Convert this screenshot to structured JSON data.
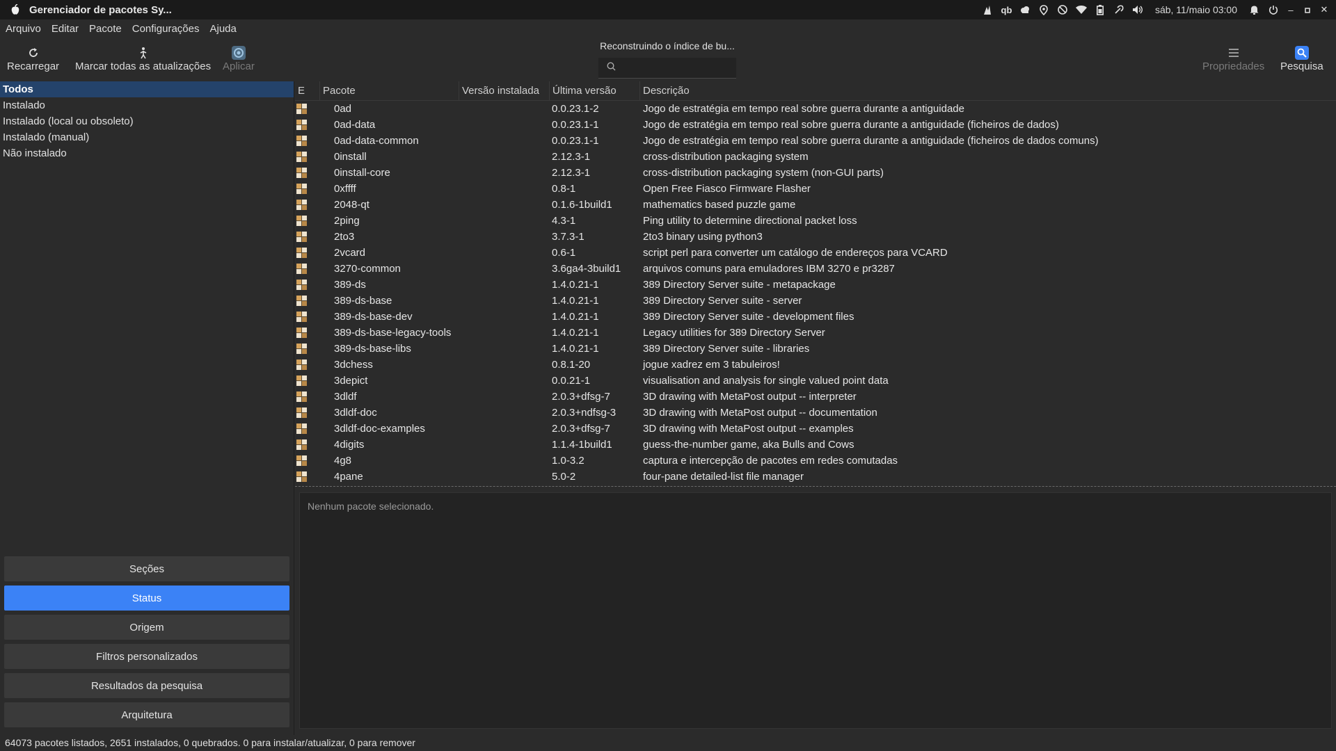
{
  "window": {
    "title": "Gerenciador de pacotes Sy...",
    "clock": "sáb, 11/maio  03:00"
  },
  "menu": [
    "Arquivo",
    "Editar",
    "Pacote",
    "Configurações",
    "Ajuda"
  ],
  "toolbar": {
    "reload": "Recarregar",
    "mark_all": "Marcar todas as atualizações",
    "apply": "Aplicar",
    "properties": "Propriedades",
    "search": "Pesquisa"
  },
  "search": {
    "status": "Reconstruindo o índice de bu...",
    "placeholder": ""
  },
  "filters": [
    "Todos",
    "Instalado",
    "Instalado (local ou obsoleto)",
    "Instalado (manual)",
    "Não instalado"
  ],
  "sidebar_buttons": [
    "Seções",
    "Status",
    "Origem",
    "Filtros personalizados",
    "Resultados da pesquisa",
    "Arquitetura"
  ],
  "columns": {
    "e": "E",
    "package": "Pacote",
    "installed": "Versão instalada",
    "latest": "Última versão",
    "description": "Descrição"
  },
  "packages": [
    {
      "name": "0ad",
      "installed": "",
      "latest": "0.0.23.1-2",
      "desc": "Jogo de estratégia em tempo real  sobre guerra durante a antiguidade"
    },
    {
      "name": "0ad-data",
      "installed": "",
      "latest": "0.0.23.1-1",
      "desc": "Jogo de estratégia em tempo real  sobre guerra durante a antiguidade (ficheiros de dados)"
    },
    {
      "name": "0ad-data-common",
      "installed": "",
      "latest": "0.0.23.1-1",
      "desc": "Jogo de estratégia em tempo real  sobre guerra durante a antiguidade (ficheiros de dados comuns)"
    },
    {
      "name": "0install",
      "installed": "",
      "latest": "2.12.3-1",
      "desc": "cross-distribution packaging system"
    },
    {
      "name": "0install-core",
      "installed": "",
      "latest": "2.12.3-1",
      "desc": "cross-distribution packaging system (non-GUI parts)"
    },
    {
      "name": "0xffff",
      "installed": "",
      "latest": "0.8-1",
      "desc": "Open Free Fiasco Firmware Flasher"
    },
    {
      "name": "2048-qt",
      "installed": "",
      "latest": "0.1.6-1build1",
      "desc": "mathematics based puzzle game"
    },
    {
      "name": "2ping",
      "installed": "",
      "latest": "4.3-1",
      "desc": "Ping utility to determine directional packet loss"
    },
    {
      "name": "2to3",
      "installed": "",
      "latest": "3.7.3-1",
      "desc": "2to3 binary using python3"
    },
    {
      "name": "2vcard",
      "installed": "",
      "latest": "0.6-1",
      "desc": "script perl para converter um catálogo de endereços para VCARD"
    },
    {
      "name": "3270-common",
      "installed": "",
      "latest": "3.6ga4-3build1",
      "desc": "arquivos comuns para emuladores IBM 3270 e pr3287"
    },
    {
      "name": "389-ds",
      "installed": "",
      "latest": "1.4.0.21-1",
      "desc": "389 Directory Server suite - metapackage"
    },
    {
      "name": "389-ds-base",
      "installed": "",
      "latest": "1.4.0.21-1",
      "desc": "389 Directory Server suite - server"
    },
    {
      "name": "389-ds-base-dev",
      "installed": "",
      "latest": "1.4.0.21-1",
      "desc": "389 Directory Server suite - development files"
    },
    {
      "name": "389-ds-base-legacy-tools",
      "installed": "",
      "latest": "1.4.0.21-1",
      "desc": "Legacy utilities for 389 Directory Server"
    },
    {
      "name": "389-ds-base-libs",
      "installed": "",
      "latest": "1.4.0.21-1",
      "desc": "389 Directory Server suite - libraries"
    },
    {
      "name": "3dchess",
      "installed": "",
      "latest": "0.8.1-20",
      "desc": "jogue xadrez em 3 tabuleiros!"
    },
    {
      "name": "3depict",
      "installed": "",
      "latest": "0.0.21-1",
      "desc": "visualisation and analysis for single valued point data"
    },
    {
      "name": "3dldf",
      "installed": "",
      "latest": "2.0.3+dfsg-7",
      "desc": "3D drawing with MetaPost output -- interpreter"
    },
    {
      "name": "3dldf-doc",
      "installed": "",
      "latest": "2.0.3+ndfsg-3",
      "desc": "3D drawing with MetaPost output -- documentation"
    },
    {
      "name": "3dldf-doc-examples",
      "installed": "",
      "latest": "2.0.3+dfsg-7",
      "desc": "3D drawing with MetaPost output -- examples"
    },
    {
      "name": "4digits",
      "installed": "",
      "latest": "1.1.4-1build1",
      "desc": "guess-the-number game, aka Bulls and Cows"
    },
    {
      "name": "4g8",
      "installed": "",
      "latest": "1.0-3.2",
      "desc": "captura e intercepção de pacotes em redes comutadas"
    },
    {
      "name": "4pane",
      "installed": "",
      "latest": "5.0-2",
      "desc": "four-pane detailed-list file manager"
    }
  ],
  "details": {
    "empty_message": "Nenhum pacote selecionado."
  },
  "statusbar": {
    "text": "64073 pacotes listados, 2651 instalados, 0 quebrados. 0 para instalar/atualizar, 0 para remover"
  },
  "colors": {
    "accent": "#3b82f6",
    "selection": "#24436b"
  }
}
